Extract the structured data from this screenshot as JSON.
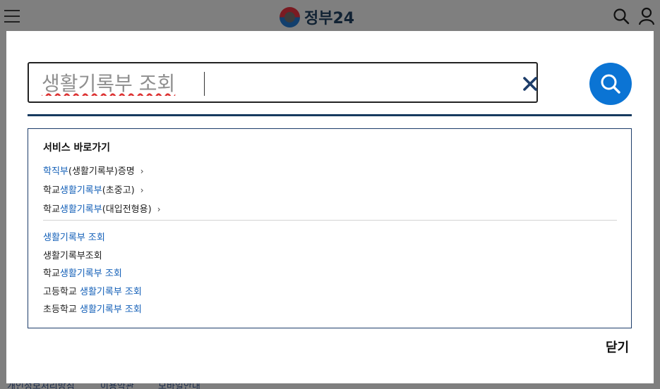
{
  "header": {
    "logo_text": "정부24",
    "menu_icon": "hamburger-menu-icon",
    "search_icon": "search-icon",
    "user_icon": "user-icon"
  },
  "search": {
    "query": "생활기록부 조회",
    "clear_icon": "close-x-icon",
    "submit_icon": "search-icon",
    "accent_color": "#0b74d4"
  },
  "shortcuts": {
    "title": "서비스 바로가기",
    "items": [
      {
        "pre": "",
        "hl": "학직부",
        "post": "(생활기록부)증명"
      },
      {
        "pre": "학교",
        "hl": "생활기록부",
        "post": "(초중고)"
      },
      {
        "pre": "학교",
        "hl": "생활기록부",
        "post": "(대입전형용)"
      }
    ],
    "chevron": "›"
  },
  "keywords": [
    {
      "pre": "",
      "hl": "생활기록부 조회",
      "post": ""
    },
    {
      "pre": "생활기록부조회",
      "hl": "",
      "post": ""
    },
    {
      "pre": "학교",
      "hl": "생활기록부 조회",
      "post": ""
    },
    {
      "pre": "고등학교 ",
      "hl": "생활기록부 조회",
      "post": ""
    },
    {
      "pre": "초등학교 ",
      "hl": "생활기록부 조회",
      "post": ""
    }
  ],
  "close_label": "닫기",
  "footer": {
    "links": [
      "개인정보처리방침",
      "이용약관",
      "모바일안내"
    ]
  }
}
